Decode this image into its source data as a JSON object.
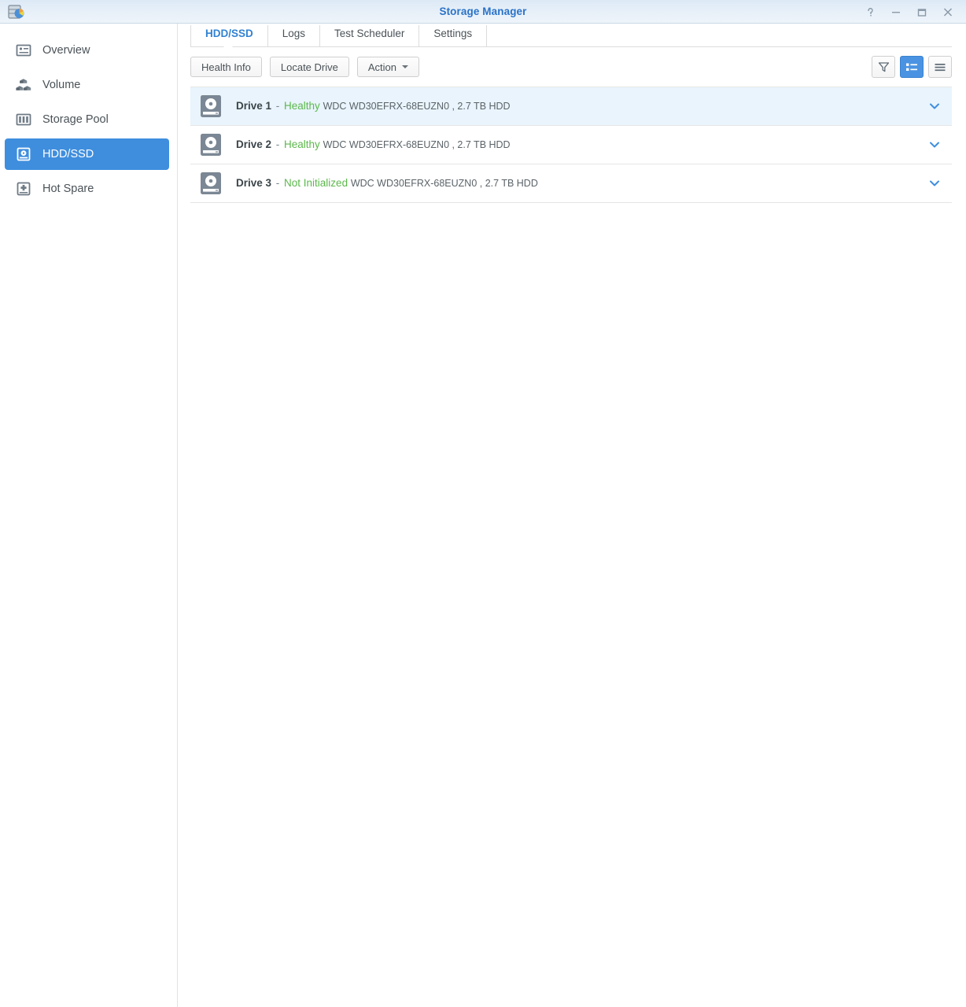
{
  "window": {
    "title": "Storage Manager",
    "app_icon": "storage-manager-icon",
    "controls": [
      {
        "name": "help-button",
        "glyph": "?"
      },
      {
        "name": "minimize-button",
        "glyph": "−"
      },
      {
        "name": "maximize-button",
        "glyph": "□"
      },
      {
        "name": "close-button",
        "glyph": "✕"
      }
    ]
  },
  "sidebar": {
    "items": [
      {
        "label": "Overview",
        "icon": "overview-icon",
        "active": false
      },
      {
        "label": "Volume",
        "icon": "volume-icon",
        "active": false
      },
      {
        "label": "Storage Pool",
        "icon": "storage-pool-icon",
        "active": false
      },
      {
        "label": "HDD/SSD",
        "icon": "hdd-ssd-icon",
        "active": true
      },
      {
        "label": "Hot Spare",
        "icon": "hot-spare-icon",
        "active": false
      }
    ]
  },
  "tabs": [
    {
      "label": "HDD/SSD",
      "active": true
    },
    {
      "label": "Logs",
      "active": false
    },
    {
      "label": "Test Scheduler",
      "active": false
    },
    {
      "label": "Settings",
      "active": false
    }
  ],
  "toolbar": {
    "health_info_label": "Health Info",
    "locate_drive_label": "Locate Drive",
    "action_label": "Action",
    "view_buttons": [
      {
        "name": "filter-button",
        "icon": "filter-icon",
        "active": false
      },
      {
        "name": "detail-view-button",
        "icon": "detail-list-icon",
        "active": true
      },
      {
        "name": "list-view-button",
        "icon": "list-icon",
        "active": false
      }
    ]
  },
  "drives": [
    {
      "name": "Drive 1",
      "separator": "-",
      "status": "Healthy",
      "status_color": "#5cb84c",
      "details": "WDC WD30EFRX-68EUZN0 , 2.7 TB HDD",
      "selected": true
    },
    {
      "name": "Drive 2",
      "separator": "-",
      "status": "Healthy",
      "status_color": "#5cb84c",
      "details": "WDC WD30EFRX-68EUZN0 , 2.7 TB HDD",
      "selected": false
    },
    {
      "name": "Drive 3",
      "separator": "-",
      "status": "Not Initialized",
      "status_color": "#5cb84c",
      "details": "WDC WD30EFRX-68EUZN0 , 2.7 TB HDD",
      "selected": false
    }
  ],
  "colors": {
    "accent_blue": "#3f8ede",
    "title_blue": "#2a72c8",
    "status_green": "#5cb84c",
    "selected_row": "#e9f4fc"
  }
}
